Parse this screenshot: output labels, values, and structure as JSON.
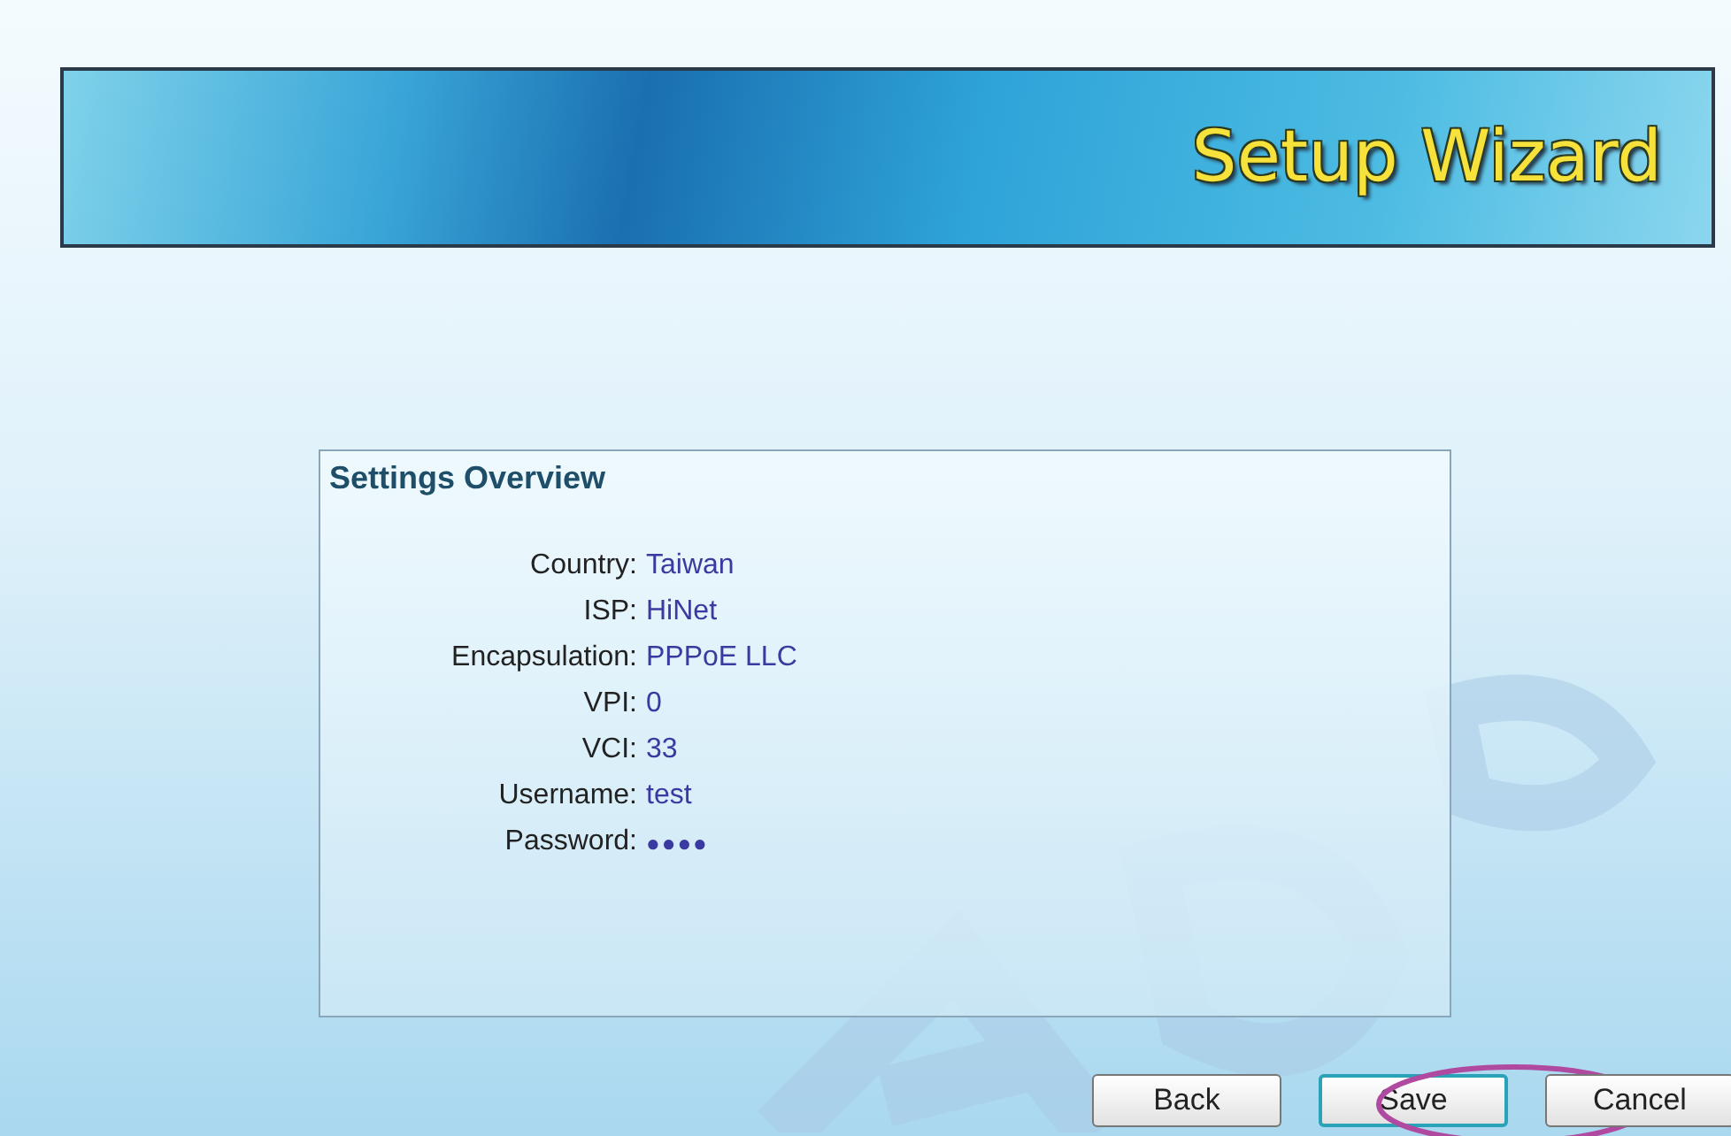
{
  "banner": {
    "title": "Setup Wizard"
  },
  "panel": {
    "title": "Settings Overview",
    "rows": [
      {
        "label": "Country:",
        "value": "Taiwan",
        "kind": "text"
      },
      {
        "label": "ISP:",
        "value": "HiNet",
        "kind": "text"
      },
      {
        "label": "Encapsulation:",
        "value": "PPPoE LLC",
        "kind": "text"
      },
      {
        "label": "VPI:",
        "value": "0",
        "kind": "text"
      },
      {
        "label": "VCI:",
        "value": "33",
        "kind": "text"
      },
      {
        "label": "Username:",
        "value": "test",
        "kind": "text"
      },
      {
        "label": "Password:",
        "value": "●●●●",
        "kind": "masked"
      }
    ]
  },
  "buttons": [
    {
      "label": "Back",
      "focused": false,
      "circled": false
    },
    {
      "label": "Save",
      "focused": true,
      "circled": true
    },
    {
      "label": "Cancel",
      "focused": false,
      "circled": false
    }
  ]
}
